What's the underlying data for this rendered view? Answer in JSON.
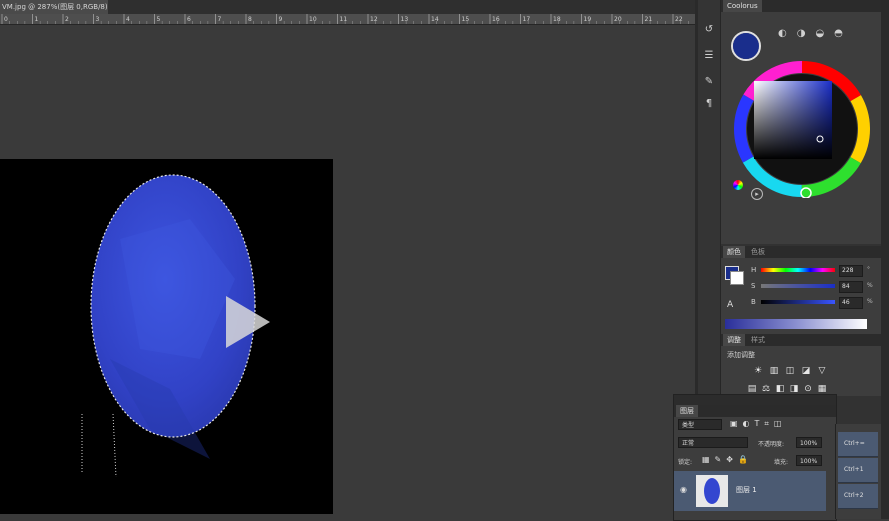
{
  "document": {
    "tab_title": "VM.jpg @ 287%(图层 0,RGB/8) *",
    "tab_close": "×",
    "ruler_ticks": [
      "0",
      "1",
      "2",
      "3",
      "4",
      "5",
      "6",
      "7",
      "8",
      "9",
      "10",
      "11",
      "12",
      "13",
      "14",
      "15",
      "16",
      "17",
      "18",
      "19",
      "20",
      "21",
      "22"
    ]
  },
  "video_overlay": {
    "play_icon": "play-icon"
  },
  "coolorus": {
    "tab": "Coolorus",
    "foreground_color": "#1a2e8c",
    "background_color": "#ffffff"
  },
  "color_panel": {
    "tabs": [
      "颜色",
      "色板"
    ],
    "sliders": [
      {
        "label": "H",
        "value": "228",
        "unit": "°"
      },
      {
        "label": "S",
        "value": "84",
        "unit": "%"
      },
      {
        "label": "B",
        "value": "46",
        "unit": "%"
      }
    ]
  },
  "adjust_panel": {
    "tabs": [
      "调整",
      "样式"
    ],
    "title": "添加调整"
  },
  "layers_panel": {
    "tab": "图层",
    "filter": "类型",
    "blend_mode": "正常",
    "opacity_label": "不透明度:",
    "opacity_value": "100%",
    "lock_label": "锁定:",
    "fill_label": "填充:",
    "fill_value": "100%",
    "layer_name": "图层 1"
  },
  "actions_panel": {
    "items": [
      "Ctrl+=",
      "Ctrl+1",
      "Ctrl+2"
    ]
  },
  "colors": {
    "ellipse_fill": "#3346d0",
    "layer_highlight": "#4b5a72"
  }
}
